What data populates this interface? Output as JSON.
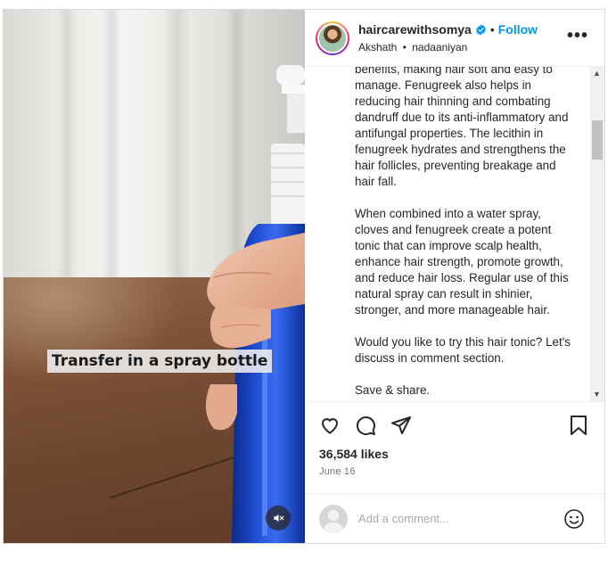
{
  "header": {
    "username": "haircarewithsomya",
    "follow_label": "Follow",
    "separator": "•",
    "audio_artist": "Akshath",
    "audio_track": "nadaaniyan",
    "more_label": "•••"
  },
  "media": {
    "overlay_text": "Transfer in a spray bottle",
    "mute_icon": "muted-speaker-icon"
  },
  "caption": {
    "paragraphs": [
      "benefits, making hair soft and easy to manage. Fenugreek also helps in reducing hair thinning and combating dandruff due to its anti-inflammatory and antifungal properties. The lecithin in fenugreek hydrates and strengthens the hair follicles, preventing breakage and hair fall.",
      "When combined into a water spray, cloves and fenugreek create a potent tonic that can improve scalp health, enhance hair strength, promote growth, and reduce hair loss. Regular use of this natural spray can result in shinier, stronger, and more manageable hair.",
      "Would you like to try this hair tonic? Let's discuss in comment section.",
      "Save & share."
    ]
  },
  "actions": {
    "icons": [
      "heart-icon",
      "comment-icon",
      "share-icon",
      "bookmark-icon"
    ]
  },
  "stats": {
    "likes": "36,584 likes",
    "date": "June 16"
  },
  "comment": {
    "placeholder": "Add a comment...",
    "emoji_icon": "emoji-icon"
  },
  "colors": {
    "follow_blue": "#0095f6",
    "verified_blue": "#0095f6",
    "text": "#262626",
    "muted_text": "#737373"
  }
}
